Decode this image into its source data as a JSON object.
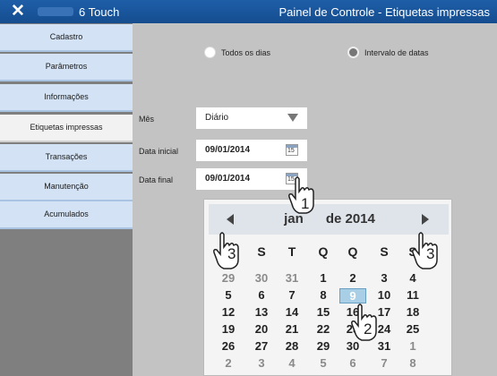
{
  "titlebar": {
    "close_icon": "close-icon",
    "app_name": "6 Touch",
    "screen_title": "Painel de Controle - Etiquetas impressas"
  },
  "sidebar": {
    "items": [
      {
        "label": "Cadastro"
      },
      {
        "label": "Parâmetros"
      },
      {
        "label": "Informações"
      },
      {
        "label": "Etiquetas impressas",
        "active": true
      },
      {
        "label": "Transações"
      },
      {
        "label": "Manutenção"
      },
      {
        "label": "Acumulados"
      }
    ]
  },
  "filters": {
    "all_days": "Todos os dias",
    "date_range": "Intervalo de datas",
    "selected": "all_days"
  },
  "form": {
    "month_label": "Mês",
    "month_value": "Diário",
    "start_label": "Data inicial",
    "start_value": "09/01/2014",
    "end_label": "Data final",
    "end_value": "09/01/2014",
    "calendar_icon_text": "15"
  },
  "calendar": {
    "title_left": "jan",
    "title_right": "de 2014",
    "weekdays": [
      "D",
      "S",
      "T",
      "Q",
      "Q",
      "S",
      "S"
    ],
    "rows": [
      [
        {
          "d": "29",
          "o": true
        },
        {
          "d": "30",
          "o": true
        },
        {
          "d": "31",
          "o": true
        },
        {
          "d": "1"
        },
        {
          "d": "2"
        },
        {
          "d": "3"
        },
        {
          "d": "4"
        }
      ],
      [
        {
          "d": "5"
        },
        {
          "d": "6"
        },
        {
          "d": "7"
        },
        {
          "d": "8"
        },
        {
          "d": "9",
          "sel": true
        },
        {
          "d": "10"
        },
        {
          "d": "11"
        }
      ],
      [
        {
          "d": "12"
        },
        {
          "d": "13"
        },
        {
          "d": "14"
        },
        {
          "d": "15"
        },
        {
          "d": "16"
        },
        {
          "d": "17"
        },
        {
          "d": "18"
        }
      ],
      [
        {
          "d": "19"
        },
        {
          "d": "20"
        },
        {
          "d": "21"
        },
        {
          "d": "22"
        },
        {
          "d": "23"
        },
        {
          "d": "24"
        },
        {
          "d": "25"
        }
      ],
      [
        {
          "d": "26"
        },
        {
          "d": "27"
        },
        {
          "d": "28"
        },
        {
          "d": "29"
        },
        {
          "d": "30"
        },
        {
          "d": "31"
        },
        {
          "d": "1",
          "o": true
        }
      ],
      [
        {
          "d": "2",
          "o": true
        },
        {
          "d": "3",
          "o": true
        },
        {
          "d": "4",
          "o": true
        },
        {
          "d": "5",
          "o": true
        },
        {
          "d": "6",
          "o": true
        },
        {
          "d": "7",
          "o": true
        },
        {
          "d": "8",
          "o": true
        }
      ]
    ]
  },
  "steps": {
    "one": "1",
    "two": "2",
    "three": "3"
  }
}
